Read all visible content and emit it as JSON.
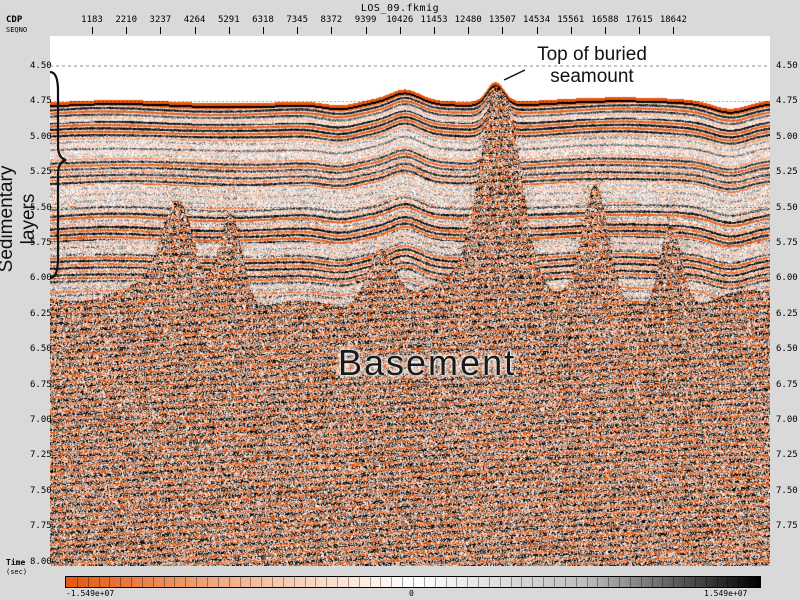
{
  "header": {
    "title": "LOS_09.fkmig",
    "cdp_label": "CDP",
    "seqno_label": "SEQNO"
  },
  "cdp_ticks": [
    "1183",
    "2210",
    "3237",
    "4264",
    "5291",
    "6318",
    "7345",
    "8372",
    "9399",
    "10426",
    "11453",
    "12480",
    "13507",
    "14534",
    "15561",
    "16588",
    "17615",
    "18642"
  ],
  "time_axis": {
    "title": "Time",
    "unit": "(sec)",
    "ticks": [
      "4.50",
      "4.75",
      "5.00",
      "5.25",
      "5.50",
      "5.75",
      "6.00",
      "6.25",
      "6.50",
      "6.75",
      "7.00",
      "7.25",
      "7.50",
      "7.75",
      "8.00"
    ]
  },
  "annotations": {
    "seamount": "Top of buried seamount",
    "basement": "Basement",
    "sedimentary": "Sedimentary layers"
  },
  "colorbar": {
    "min_label": "-1.549e+07",
    "mid_label": "0",
    "max_label": "1.549e+07",
    "low_color": "#e4570f",
    "high_color": "#000000"
  },
  "colors": {
    "background": "#d9d9d9",
    "reflector_orange": "#d94f10"
  }
}
